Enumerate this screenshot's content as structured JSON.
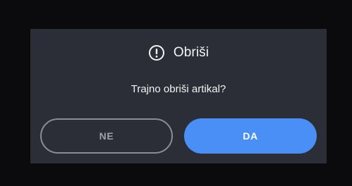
{
  "dialog": {
    "icon": "exclamation-circle-icon",
    "title": "Obriši",
    "message": "Trajno obriši artikal?",
    "cancel_label": "NE",
    "confirm_label": "DA"
  },
  "colors": {
    "backdrop": "#0b0b0d",
    "dialog_bg": "#2b2e36",
    "text": "#f2f3f5",
    "cancel_border": "#8a8d94",
    "cancel_text": "#9da0a7",
    "accent": "#4a8ff5"
  }
}
